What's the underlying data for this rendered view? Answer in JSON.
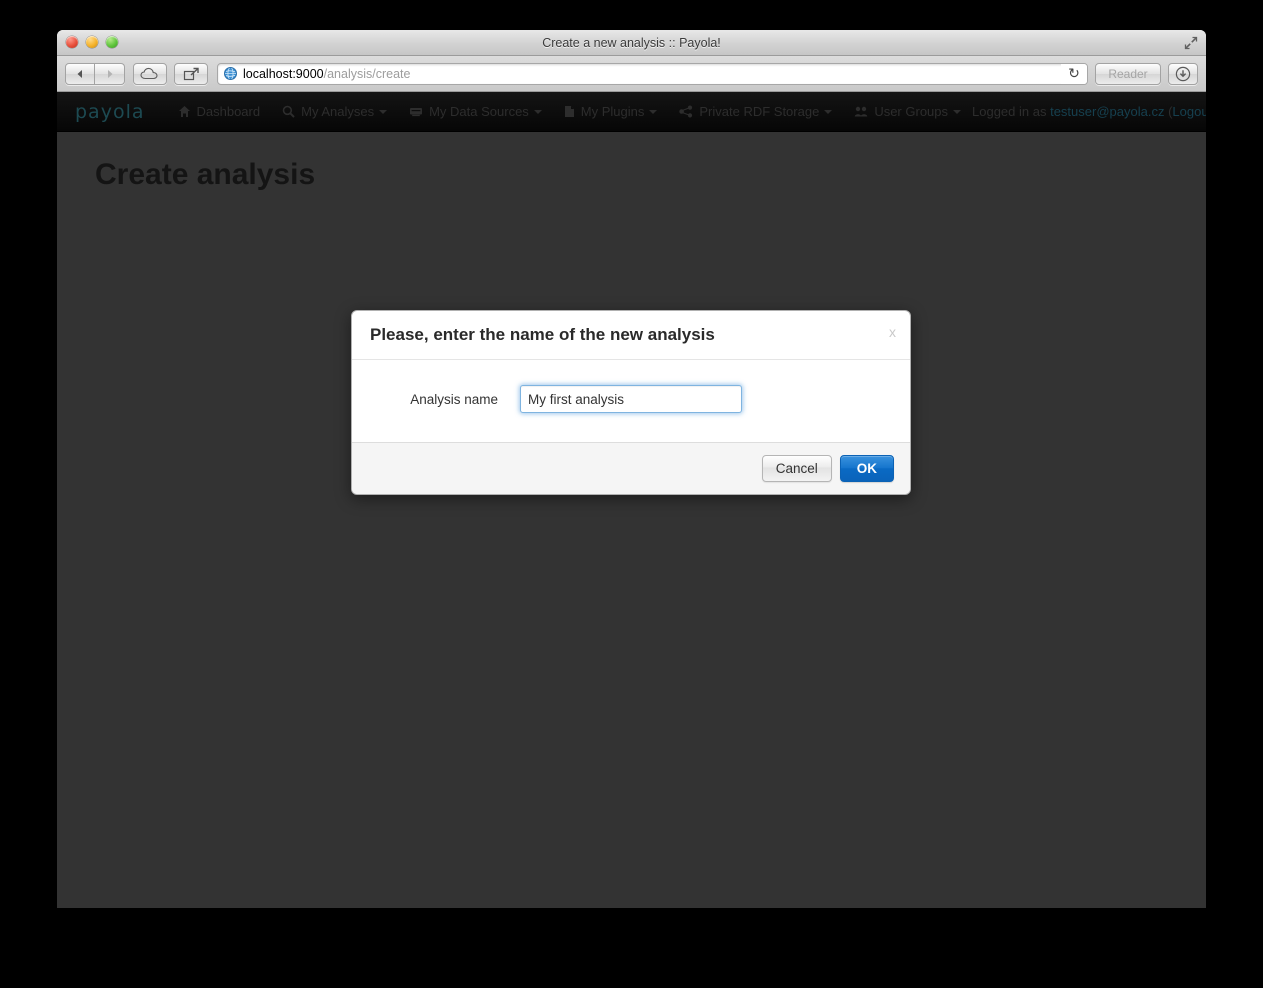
{
  "window": {
    "title": "Create a new analysis :: Payola!",
    "controls": {
      "close": "close-button",
      "minimize": "minimize-button",
      "maximize": "maximize-button"
    },
    "fullscreen_icon": "fullscreen-icon"
  },
  "toolbar": {
    "back_icon": "back-arrow-icon",
    "forward_icon": "forward-arrow-icon",
    "cloud_icon": "icloud-icon",
    "share_icon": "share-icon",
    "globe_icon": "globe-icon",
    "url_host": "localhost:9000",
    "url_path": "/analysis/create",
    "url_full": "localhost:9000/analysis/create",
    "reload_icon": "reload-icon",
    "reader_label": "Reader",
    "downloads_icon": "downloads-icon"
  },
  "navbar": {
    "brand": "payola",
    "items": [
      {
        "label": "Dashboard",
        "icon": "home-icon",
        "caret": false
      },
      {
        "label": "My Analyses",
        "icon": "search-icon",
        "caret": true
      },
      {
        "label": "My Data Sources",
        "icon": "database-icon",
        "caret": true
      },
      {
        "label": "My Plugins",
        "icon": "file-icon",
        "caret": true
      },
      {
        "label": "Private RDF Storage",
        "icon": "share-nodes-icon",
        "caret": true
      },
      {
        "label": "User Groups",
        "icon": "users-icon",
        "caret": true
      }
    ],
    "logged_in_prefix": "Logged in as ",
    "user_email": "testuser@payola.cz",
    "logout_open": " (",
    "logout_label": "Logout",
    "logout_close": ")"
  },
  "page": {
    "heading": "Create analysis"
  },
  "modal": {
    "title": "Please, enter the name of the new analysis",
    "close_label": "x",
    "field_label": "Analysis name",
    "field_value": "My first analysis",
    "field_placeholder": "",
    "cancel_label": "Cancel",
    "ok_label": "OK"
  },
  "colors": {
    "page_background": "#333333",
    "navbar_background": "#0d0d0d",
    "brand_teal": "#1d4a52",
    "link_teal": "#16404f",
    "primary_button": "#0a6ac4",
    "input_focus_glow": "#6eaae1"
  }
}
